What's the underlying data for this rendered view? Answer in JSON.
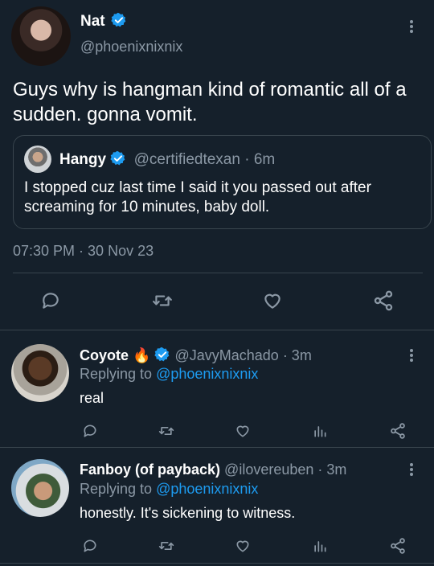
{
  "main_tweet": {
    "display_name": "Nat",
    "handle": "@phoenixnixnix",
    "text_line1": "Guys why is hangman kind of romantic all of a",
    "text_line2": "sudden. gonna vomit.",
    "timestamp": "07:30 PM · 30 Nov 23"
  },
  "quoted_tweet": {
    "display_name": "Hangy",
    "handle_time": "@certifiedtexan · 6m",
    "text_line1": "I stopped cuz last time I said it you passed out after",
    "text_line2": "screaming for 10 minutes, baby doll."
  },
  "replies": [
    {
      "display_name": "Coyote",
      "emoji": "🔥",
      "handle_time": "@JavyMachado · 3m",
      "replying_prefix": "Replying to",
      "replying_handle": "@phoenixnixnix",
      "text": "real"
    },
    {
      "display_name": "Fanboy (of payback)",
      "handle_time": "@ilovereuben · 3m",
      "replying_prefix": "Replying to",
      "replying_handle": "@phoenixnixnix",
      "text": "honestly. It's sickening to witness."
    }
  ],
  "colors": {
    "background": "#15202b",
    "accent": "#1d9bf0",
    "muted": "#8b98a5",
    "divider": "#38444d",
    "emoji_fire": "#f4900c"
  },
  "icons": [
    "verified-badge-icon",
    "more-options-icon",
    "reply-icon",
    "retweet-icon",
    "like-icon",
    "share-icon",
    "analytics-icon",
    "fire-emoji-icon"
  ]
}
